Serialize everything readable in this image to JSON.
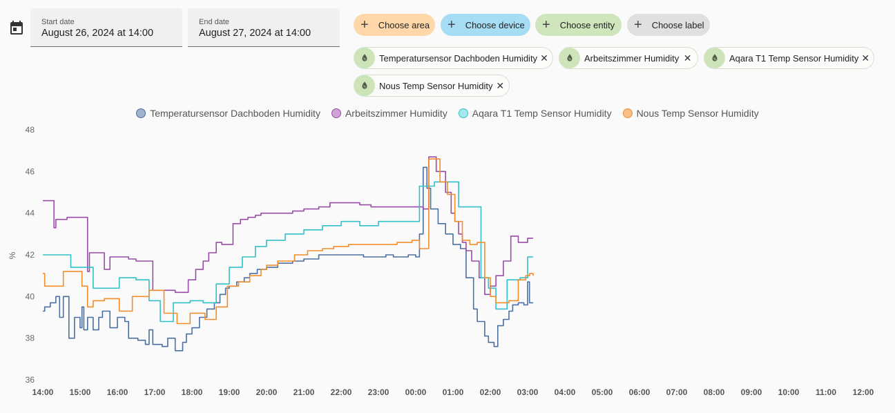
{
  "date_range": {
    "start_label": "Start date",
    "start_value": "August 26, 2024 at 14:00",
    "end_label": "End date",
    "end_value": "August 27, 2024 at 14:00"
  },
  "target_chips": [
    {
      "label": "Choose area",
      "color": "#ffd7a8"
    },
    {
      "label": "Choose device",
      "color": "#a7dcf5"
    },
    {
      "label": "Choose entity",
      "color": "#cfe6bc"
    },
    {
      "label": "Choose label",
      "color": "#e0e0e0"
    }
  ],
  "selected_entities": [
    {
      "label": "Temperatursensor Dachboden Humidity",
      "icon": "water-drop-percent-icon"
    },
    {
      "label": "Arbeitszimmer Humidity",
      "icon": "water-drop-percent-icon"
    },
    {
      "label": "Aqara T1 Temp Sensor Humidity",
      "icon": "water-drop-percent-icon"
    },
    {
      "label": "Nous Temp Sensor Humidity",
      "icon": "water-drop-percent-icon"
    }
  ],
  "chart_data": {
    "type": "line",
    "step": true,
    "ylabel": "%",
    "ylim": [
      36,
      48
    ],
    "yticks": [
      36,
      38,
      40,
      42,
      44,
      46,
      48
    ],
    "xticks": [
      "14:00",
      "15:00",
      "16:00",
      "17:00",
      "18:00",
      "19:00",
      "20:00",
      "21:00",
      "22:00",
      "23:00",
      "00:00",
      "01:00",
      "02:00",
      "03:00",
      "04:00",
      "05:00",
      "06:00",
      "07:00",
      "08:00",
      "09:00",
      "10:00",
      "11:00",
      "12:00"
    ],
    "legend_position": "top-center",
    "series": [
      {
        "name": "Temperatursensor Dachboden Humidity",
        "color": "#4a6fa0",
        "fill": "#9fb3cf",
        "points": [
          [
            0,
            39.3
          ],
          [
            0.05,
            39.5
          ],
          [
            0.2,
            39.7
          ],
          [
            0.35,
            40.0
          ],
          [
            0.45,
            39.0
          ],
          [
            0.55,
            40.0
          ],
          [
            0.7,
            38.0
          ],
          [
            0.85,
            39.0
          ],
          [
            1.0,
            38.5
          ],
          [
            1.05,
            39.5
          ],
          [
            1.1,
            38.4
          ],
          [
            1.2,
            39.0
          ],
          [
            1.35,
            38.4
          ],
          [
            1.5,
            39.0
          ],
          [
            1.6,
            39.3
          ],
          [
            1.8,
            38.5
          ],
          [
            2.0,
            39.0
          ],
          [
            2.2,
            38.8
          ],
          [
            2.3,
            38.0
          ],
          [
            2.55,
            37.9
          ],
          [
            2.75,
            37.7
          ],
          [
            2.85,
            38.4
          ],
          [
            2.95,
            37.7
          ],
          [
            3.2,
            37.6
          ],
          [
            3.35,
            38.0
          ],
          [
            3.55,
            37.4
          ],
          [
            3.75,
            37.8
          ],
          [
            3.85,
            38.2
          ],
          [
            4.0,
            38.5
          ],
          [
            4.2,
            39.0
          ],
          [
            4.4,
            39.4
          ],
          [
            4.6,
            39.7
          ],
          [
            4.75,
            40.1
          ],
          [
            4.9,
            40.4
          ],
          [
            5.0,
            40.5
          ],
          [
            5.2,
            40.7
          ],
          [
            5.4,
            40.9
          ],
          [
            5.55,
            41.1
          ],
          [
            5.75,
            41.3
          ],
          [
            6.0,
            41.4
          ],
          [
            6.3,
            41.6
          ],
          [
            6.7,
            41.7
          ],
          [
            7.0,
            41.8
          ],
          [
            7.4,
            42.0
          ],
          [
            8.2,
            42.0
          ],
          [
            8.6,
            41.9
          ],
          [
            9.2,
            42.0
          ],
          [
            9.4,
            41.9
          ],
          [
            9.8,
            42.0
          ],
          [
            10.0,
            41.9
          ],
          [
            10.1,
            43.0
          ],
          [
            10.2,
            46.2
          ],
          [
            10.3,
            45.2
          ],
          [
            10.4,
            44.2
          ],
          [
            10.6,
            43.5
          ],
          [
            10.8,
            43.0
          ],
          [
            11.0,
            42.5
          ],
          [
            11.2,
            42.3
          ],
          [
            11.35,
            40.9
          ],
          [
            11.55,
            39.4
          ],
          [
            11.65,
            38.8
          ],
          [
            11.85,
            38.1
          ],
          [
            11.95,
            37.8
          ],
          [
            12.1,
            37.6
          ],
          [
            12.2,
            38.6
          ],
          [
            12.35,
            38.9
          ],
          [
            12.5,
            39.3
          ],
          [
            12.6,
            39.6
          ],
          [
            12.75,
            39.7
          ],
          [
            12.9,
            39.6
          ],
          [
            13.0,
            40.7
          ],
          [
            13.05,
            39.7
          ],
          [
            13.15,
            39.7
          ]
        ]
      },
      {
        "name": "Arbeitszimmer Humidity",
        "color": "#9a4ba8",
        "fill": "#cfa3d6",
        "points": [
          [
            0,
            44.6
          ],
          [
            0.3,
            43.3
          ],
          [
            0.35,
            43.7
          ],
          [
            0.65,
            43.8
          ],
          [
            1.2,
            41.2
          ],
          [
            1.25,
            42.1
          ],
          [
            1.65,
            41.3
          ],
          [
            1.8,
            41.9
          ],
          [
            2.3,
            41.8
          ],
          [
            2.5,
            41.7
          ],
          [
            2.95,
            40.3
          ],
          [
            3.25,
            40.3
          ],
          [
            3.55,
            40.2
          ],
          [
            3.9,
            40.8
          ],
          [
            4.1,
            41.3
          ],
          [
            4.3,
            41.7
          ],
          [
            4.45,
            42.1
          ],
          [
            4.65,
            42.6
          ],
          [
            4.8,
            42.5
          ],
          [
            5.0,
            42.5
          ],
          [
            5.1,
            43.5
          ],
          [
            5.3,
            43.7
          ],
          [
            5.5,
            43.8
          ],
          [
            5.7,
            43.9
          ],
          [
            5.85,
            44.0
          ],
          [
            6.3,
            44.0
          ],
          [
            6.7,
            44.1
          ],
          [
            7.0,
            44.2
          ],
          [
            7.4,
            44.3
          ],
          [
            7.7,
            44.5
          ],
          [
            8.2,
            44.5
          ],
          [
            8.5,
            44.4
          ],
          [
            8.8,
            44.3
          ],
          [
            9.2,
            44.3
          ],
          [
            9.5,
            44.3
          ],
          [
            10.0,
            44.3
          ],
          [
            10.2,
            44.2
          ],
          [
            10.35,
            46.7
          ],
          [
            10.55,
            46.0
          ],
          [
            10.8,
            45.0
          ],
          [
            10.95,
            44.0
          ],
          [
            11.05,
            43.6
          ],
          [
            11.15,
            43.0
          ],
          [
            11.25,
            42.6
          ],
          [
            11.35,
            42.2
          ],
          [
            11.5,
            41.7
          ],
          [
            11.7,
            40.9
          ],
          [
            11.85,
            40.1
          ],
          [
            12.0,
            40.5
          ],
          [
            12.15,
            41.0
          ],
          [
            12.35,
            41.7
          ],
          [
            12.55,
            42.9
          ],
          [
            12.75,
            42.6
          ],
          [
            13.0,
            42.8
          ],
          [
            13.15,
            42.8
          ]
        ]
      },
      {
        "name": "Aqara T1 Temp Sensor Humidity",
        "color": "#2fc0c8",
        "fill": "#a6e8ec",
        "points": [
          [
            0,
            42.0
          ],
          [
            0.75,
            41.4
          ],
          [
            1.1,
            41.4
          ],
          [
            1.35,
            40.4
          ],
          [
            1.8,
            40.4
          ],
          [
            2.05,
            40.9
          ],
          [
            2.5,
            40.8
          ],
          [
            2.85,
            39.8
          ],
          [
            3.15,
            38.8
          ],
          [
            3.5,
            39.7
          ],
          [
            3.95,
            39.8
          ],
          [
            4.3,
            39.7
          ],
          [
            4.65,
            40.6
          ],
          [
            5.0,
            41.4
          ],
          [
            5.35,
            41.9
          ],
          [
            5.7,
            42.4
          ],
          [
            6.0,
            42.7
          ],
          [
            6.5,
            43.0
          ],
          [
            7.0,
            43.2
          ],
          [
            7.5,
            43.4
          ],
          [
            8.0,
            43.6
          ],
          [
            8.5,
            43.4
          ],
          [
            9.0,
            43.6
          ],
          [
            9.5,
            43.6
          ],
          [
            9.85,
            43.6
          ],
          [
            10.1,
            45.3
          ],
          [
            10.5,
            45.5
          ],
          [
            10.95,
            45.5
          ],
          [
            11.15,
            44.3
          ],
          [
            11.45,
            44.3
          ],
          [
            11.75,
            40.9
          ],
          [
            11.95,
            40.4
          ],
          [
            12.15,
            39.4
          ],
          [
            12.45,
            40.8
          ],
          [
            12.8,
            40.9
          ],
          [
            13.0,
            41.9
          ],
          [
            13.15,
            41.9
          ]
        ]
      },
      {
        "name": "Nous Temp Sensor Humidity",
        "color": "#f28c28",
        "fill": "#f7c08a",
        "points": [
          [
            0,
            41.1
          ],
          [
            0.05,
            40.5
          ],
          [
            0.4,
            40.5
          ],
          [
            0.55,
            41.2
          ],
          [
            1.05,
            40.5
          ],
          [
            1.2,
            39.5
          ],
          [
            1.35,
            39.8
          ],
          [
            1.65,
            39.9
          ],
          [
            2.05,
            39.3
          ],
          [
            2.4,
            40.0
          ],
          [
            2.85,
            40.3
          ],
          [
            3.25,
            39.2
          ],
          [
            3.6,
            38.7
          ],
          [
            3.95,
            39.2
          ],
          [
            4.35,
            38.9
          ],
          [
            4.65,
            39.5
          ],
          [
            4.95,
            40.5
          ],
          [
            5.25,
            40.7
          ],
          [
            5.55,
            41.0
          ],
          [
            5.85,
            41.3
          ],
          [
            6.0,
            41.5
          ],
          [
            6.3,
            41.7
          ],
          [
            6.75,
            42.0
          ],
          [
            7.1,
            42.2
          ],
          [
            7.5,
            42.3
          ],
          [
            7.8,
            42.4
          ],
          [
            8.2,
            42.5
          ],
          [
            8.6,
            42.5
          ],
          [
            9.0,
            42.5
          ],
          [
            9.5,
            42.6
          ],
          [
            9.9,
            42.7
          ],
          [
            10.1,
            42.3
          ],
          [
            10.35,
            46.6
          ],
          [
            10.65,
            45.5
          ],
          [
            10.85,
            44.9
          ],
          [
            11.05,
            43.6
          ],
          [
            11.25,
            42.7
          ],
          [
            11.45,
            42.5
          ],
          [
            11.65,
            42.6
          ],
          [
            11.85,
            40.9
          ],
          [
            12.0,
            40.0
          ],
          [
            12.15,
            39.7
          ],
          [
            12.5,
            39.8
          ],
          [
            12.75,
            40.8
          ],
          [
            12.95,
            41.0
          ],
          [
            13.05,
            41.1
          ],
          [
            13.15,
            41.0
          ]
        ]
      }
    ]
  }
}
